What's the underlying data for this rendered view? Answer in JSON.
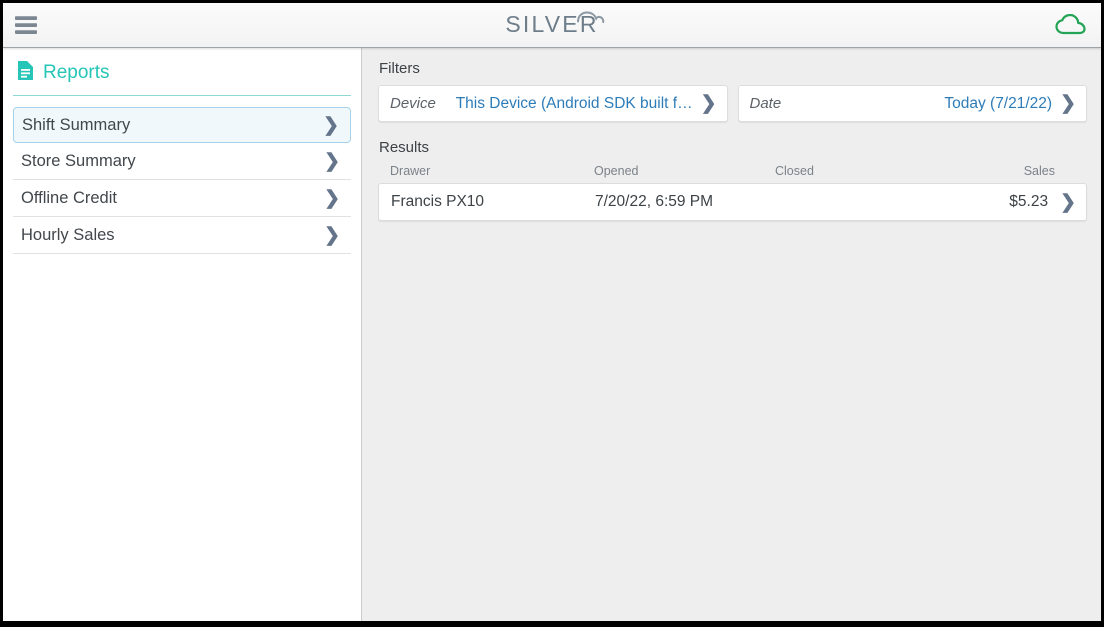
{
  "header": {
    "menu_icon": "hamburger-menu-icon",
    "logo_text": "SILVER",
    "logo_cloud_icon": "cloud-icon",
    "status_icon": "cloud-connected-icon",
    "status_color": "#22a355",
    "logo_color": "#6e7d8a"
  },
  "sidebar": {
    "title": "Reports",
    "title_icon": "document-report-icon",
    "accent_color": "#25c6b7",
    "items": [
      {
        "label": "Shift Summary",
        "selected": true,
        "chevron": "chevron-right-icon"
      },
      {
        "label": "Store Summary",
        "selected": false,
        "chevron": "chevron-right-icon"
      },
      {
        "label": "Offline Credit",
        "selected": false,
        "chevron": "chevron-right-icon"
      },
      {
        "label": "Hourly Sales",
        "selected": false,
        "chevron": "chevron-right-icon"
      }
    ]
  },
  "main": {
    "filters_title": "Filters",
    "filters": [
      {
        "label": "Device",
        "value": "This Device (Android SDK built f…",
        "chevron": "chevron-right-icon"
      },
      {
        "label": "Date",
        "value": "Today (7/21/22)",
        "chevron": "chevron-right-icon"
      }
    ],
    "results_title": "Results",
    "table": {
      "columns": [
        "Drawer",
        "Opened",
        "Closed",
        "Sales"
      ],
      "rows": [
        {
          "drawer": "Francis PX10",
          "opened": "7/20/22, 6:59 PM",
          "closed": "",
          "sales": "$5.23",
          "chevron": "chevron-right-icon"
        }
      ]
    }
  },
  "colors": {
    "link": "#2d7cb8",
    "selected_bg": "#f1f8fc",
    "selected_border": "#a6d3e9",
    "panel_bg": "#eeeeee"
  }
}
